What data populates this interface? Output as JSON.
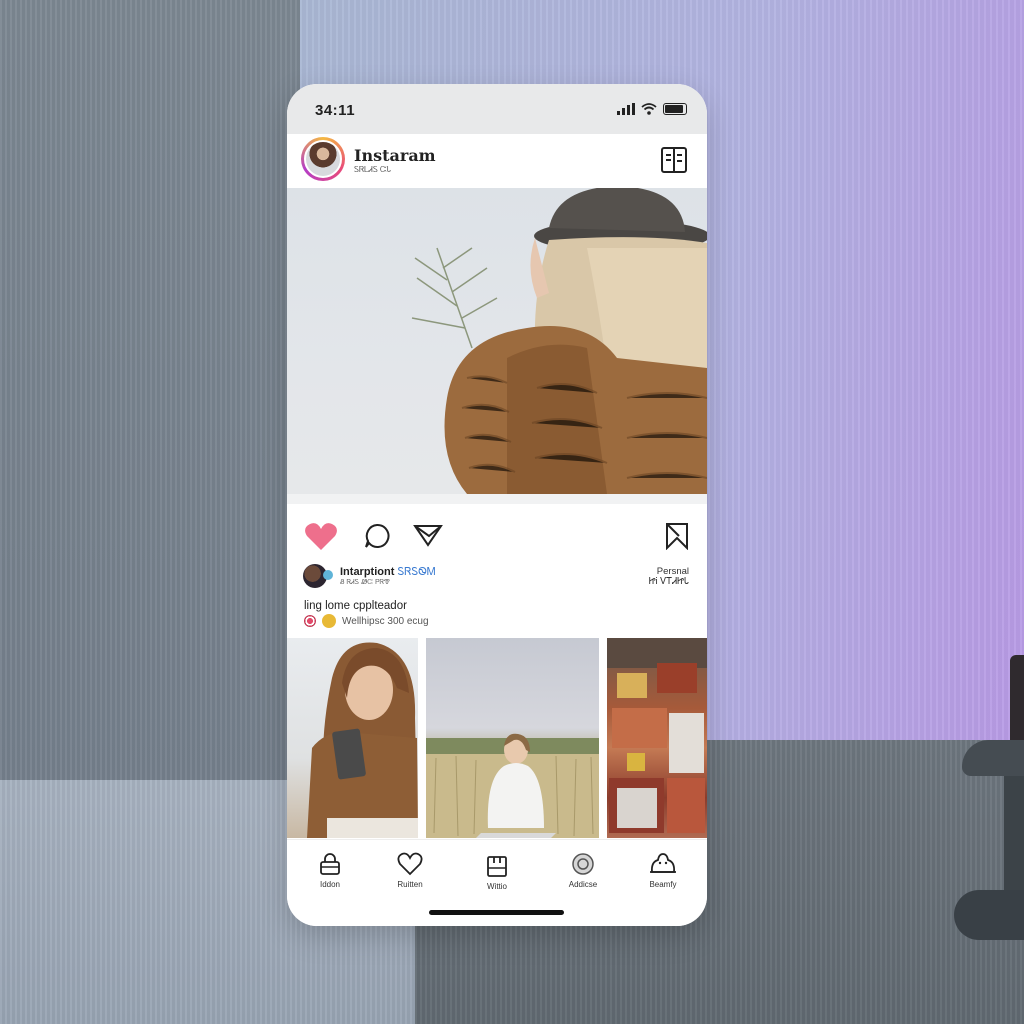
{
  "status_bar": {
    "time": "34:11"
  },
  "header": {
    "title": "Instaram",
    "subtitle": "ᏚᏒᏞᏗᏚ ᏨᏓ"
  },
  "owner": {
    "name": "Intarptiont",
    "handle": "ᏚᏒᏚᏫᎷ",
    "sub": "Ᏸ ᏒᏗᏚ ᏪᏨ ᏢᏒᏡ",
    "right_line1": "Persnal",
    "right_line2": "ᏥᎥ ᏙᎢᏗᏥᏓ"
  },
  "caption": {
    "text": "ling lome cpplteador",
    "meta": "Wellhipsc 300 ecug"
  },
  "bottom_nav": {
    "items": [
      {
        "label": "Iddon",
        "icon": "lock-icon"
      },
      {
        "label": "Ruitten",
        "icon": "heart-outline-icon"
      },
      {
        "label": "Wittio",
        "icon": "bag-icon"
      },
      {
        "label": "Addicse",
        "icon": "circle-icon"
      },
      {
        "label": "Beamfy",
        "icon": "creature-icon"
      }
    ]
  },
  "colors": {
    "like_heart": "#ee6f8c",
    "handle_blue": "#3b7bd1",
    "story_ring": "#e8497a"
  }
}
